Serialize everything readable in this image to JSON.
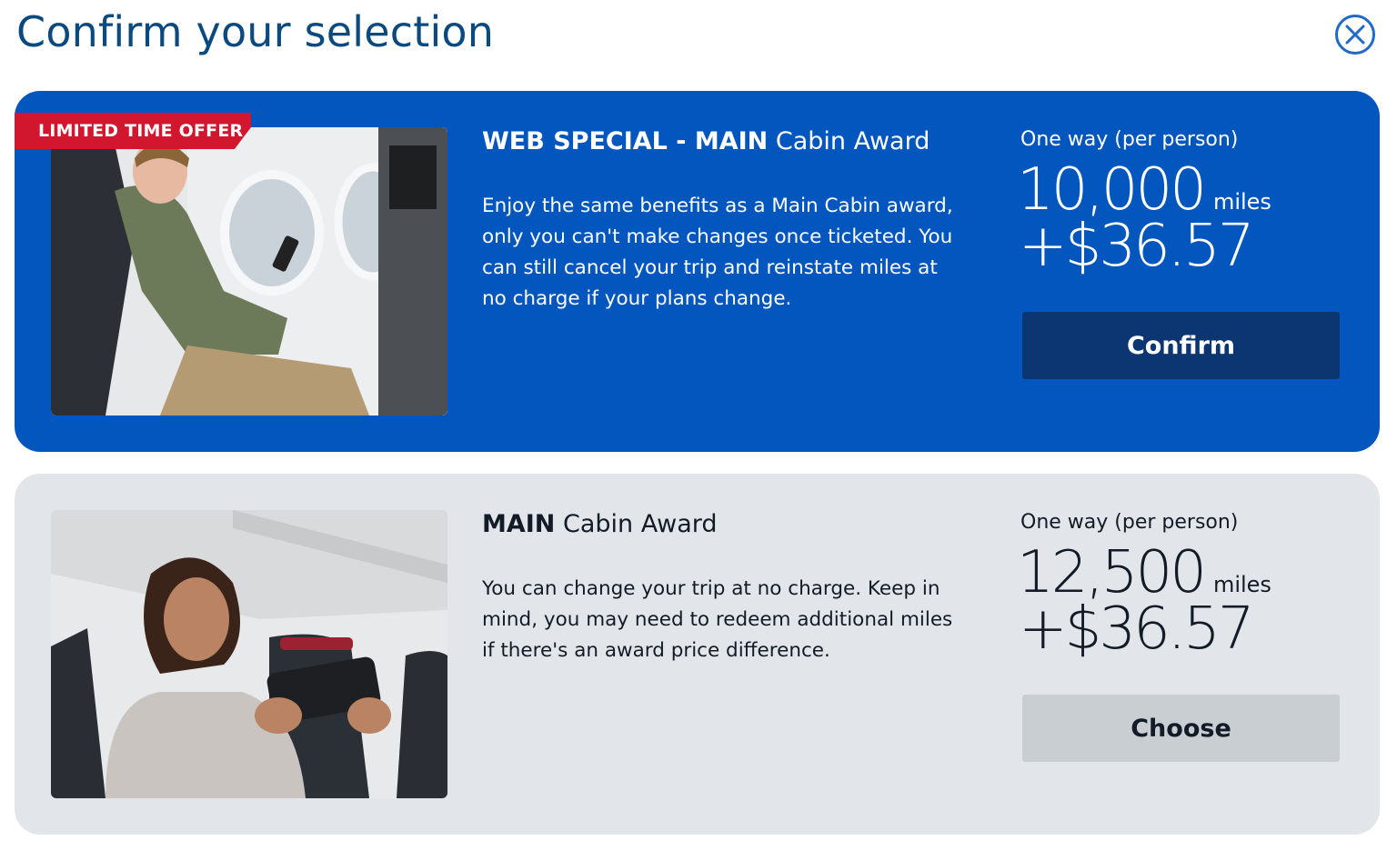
{
  "page": {
    "title": "Confirm your selection"
  },
  "cards": [
    {
      "badge": "LIMITED TIME OFFER",
      "title_bold": "WEB SPECIAL - MAIN",
      "title_rest": " Cabin Award",
      "description": "Enjoy the same benefits as a Main Cabin award, only you can't make changes once ticketed. You can still cancel your trip and reinstate miles at no charge if your plans change.",
      "price_label": "One way (per person)",
      "miles": "10,000",
      "miles_unit": "miles",
      "cash": "+$36.57",
      "button": "Confirm",
      "accent": "#0256bd"
    },
    {
      "title_bold": "MAIN",
      "title_rest": " Cabin Award",
      "description": "You can change your trip at no charge. Keep in mind, you may need to redeem additional miles if there's an award price difference.",
      "price_label": "One way (per person)",
      "miles": "12,500",
      "miles_unit": "miles",
      "cash": "+$36.57",
      "button": "Choose",
      "accent": "#e2e6ea"
    }
  ],
  "icons": {
    "close": "close-icon"
  }
}
